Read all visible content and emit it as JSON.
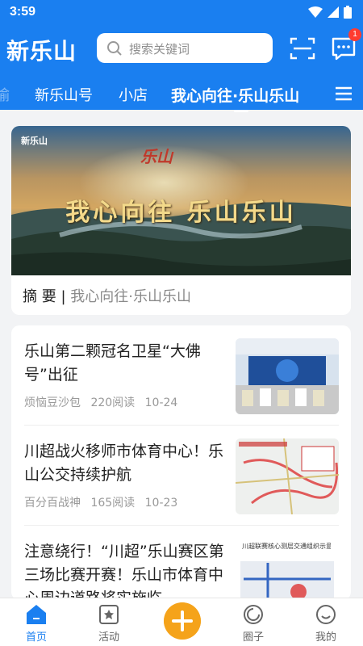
{
  "status": {
    "time": "3:59"
  },
  "header": {
    "logo": "新乐山",
    "search_placeholder": "搜索关键词",
    "message_badge": "1"
  },
  "tabs": [
    {
      "label": "新乐山号"
    },
    {
      "label": "小店"
    },
    {
      "label": "我心向往·乐山乐山",
      "active": true
    }
  ],
  "featured": {
    "banner_brand": "新乐山",
    "banner_logo_text": "乐山",
    "banner_heading": "我心向往 乐山乐山",
    "abstract_label": "摘 要",
    "abstract_sep": "|",
    "abstract_text": "我心向往·乐山乐山"
  },
  "news": [
    {
      "title": "乐山第二颗冠名卫星“大佛号”出征",
      "author": "烦恼豆沙包",
      "reads": "220阅读",
      "date": "10-24"
    },
    {
      "title": "川超战火移师市体育中心！乐山公交持续护航",
      "author": "百分百战神",
      "reads": "165阅读",
      "date": "10-23"
    },
    {
      "title": "注意绕行！“川超”乐山赛区第三场比赛开赛！乐山市体育中心周边道路将实施临",
      "author": "",
      "reads": "",
      "date": ""
    }
  ],
  "thumb_caption": "川超联赛核心测层交通组织示意图",
  "bottom_nav": [
    {
      "label": "首页",
      "active": true
    },
    {
      "label": "活动"
    },
    {
      "label": "圈子"
    },
    {
      "label": "我的"
    }
  ],
  "colors": {
    "primary": "#1a7ff0",
    "accent": "#f5a31a",
    "badge": "#ff3b30"
  }
}
